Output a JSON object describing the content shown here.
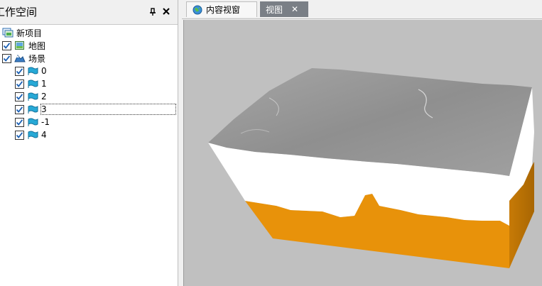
{
  "workspace": {
    "title": "工作空间",
    "tree": [
      {
        "label": "新项目",
        "icon": "project-icon",
        "checked": null
      },
      {
        "label": "地图",
        "icon": "map-icon",
        "checked": true
      },
      {
        "label": "场景",
        "icon": "scene-icon",
        "checked": true
      }
    ],
    "layers": [
      {
        "label": "0",
        "checked": true
      },
      {
        "label": "1",
        "checked": true
      },
      {
        "label": "2",
        "checked": true
      },
      {
        "label": "3",
        "checked": true,
        "focused": true
      },
      {
        "label": "-1",
        "checked": true
      },
      {
        "label": "4",
        "checked": true
      }
    ]
  },
  "tabs": [
    {
      "label": "内容视窗",
      "icon": "globe-icon",
      "active": false
    },
    {
      "label": "视图",
      "active": true,
      "close": "✕"
    }
  ],
  "colors": {
    "terrain_top": "#9c9c9c",
    "terrain_white": "#ffffff",
    "terrain_orange": "#e8920a",
    "background": "#c0c0c0",
    "accent_check": "#1a5fb4"
  }
}
